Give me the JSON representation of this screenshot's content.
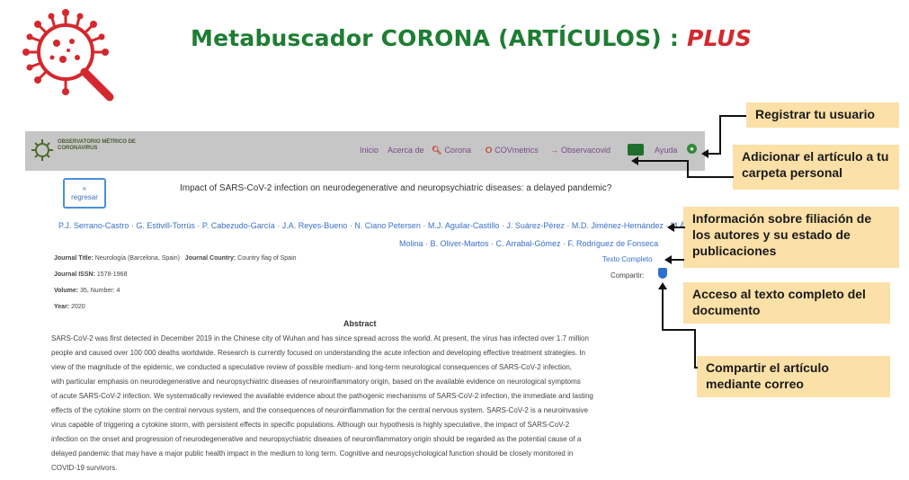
{
  "header": {
    "title_main": "Metabuscador CORONA (ARTÍCULOS) : ",
    "title_plus": "PLUS"
  },
  "navbar": {
    "org_name": "OBSERVATORIO MÉTRICO DE CORONAVIRUS",
    "items": [
      "Inicio",
      "Acerca de",
      "Corona",
      "COVmetrics",
      "Observacovid",
      "Ayuda"
    ]
  },
  "article": {
    "back_label": "regresar",
    "title": "Impact of SARS-CoV-2 infection on neurodegenerative and neuropsychiatric diseases: a delayed pandemic?",
    "authors_line1": "P.J. Serrano-Castro · G. Estivill-Torrús · P. Cabezudo-García · J.A. Reyes-Bueno · N. Ciano Petersen · M.J. Aguilar-Castillo · J. Suárez-Pérez · M.D. Jiménez-Hernández · M.Á. Moya",
    "authors_line2": "Molina · B. Oliver-Martos · C. Arrabal-Gómez · F. Rodríguez de Fonseca",
    "journal_title": "Neurología (Barcelona, Spain)",
    "journal_country": "Country flag of Spain",
    "issn": "1578-1968",
    "volume_number": "35, Number: 4",
    "year": "2020",
    "meta_labels": {
      "journal_title": "Journal Title:",
      "journal_country": "Journal Country:",
      "issn": "Journal ISSN:",
      "volume": "Volume:",
      "year": "Year:"
    },
    "full_text_link": "Texto Completo",
    "share_label": "Compartir:",
    "abstract_heading": "Abstract",
    "abstract_lines": [
      "SARS-CoV-2 was first detected in December 2019 in the Chinese city of Wuhan and has since spread across the world. At present, the virus has infected over 1.7 million",
      "people and caused over 100 000 deaths worldwide. Research is currently focused on understanding the acute infection and developing effective treatment strategies. In",
      "view of the magnitude of the epidemic, we conducted a speculative review of possible medium- and long-term neurological consequences of SARS-CoV-2 infection,",
      "with particular emphasis on neurodegenerative and neuropsychiatric diseases of neuroinflammatory origin, based on the available evidence on neurological symptoms",
      "of acute SARS-CoV-2 infection. We systematically reviewed the available evidence about the pathogenic mechanisms of SARS-CoV-2 infection, the immediate and lasting",
      "effects of the cytokine storm on the central nervous system, and the consequences of neuroinflammation for the central nervous system. SARS-CoV-2 is a neuroinvasive",
      "virus capable of triggering a cytokine storm, with persistent effects in specific populations. Although our hypothesis is highly speculative, the impact of SARS-CoV-2",
      "infection on the onset and progression of neurodegenerative and neuropsychiatric diseases of neuroinflammatory origin should be regarded as the potential cause of a",
      "delayed pandemic that may have a major public health impact in the medium to long term. Cognitive and neuropsychological function should be closely monitored in",
      "COVID-19 survivors."
    ]
  },
  "callouts": {
    "register": "Registrar tu usuario",
    "add_folder": "Adicionar el artículo a tu carpeta personal",
    "affiliation": "Información sobre filiación de los autores y su estado de publicaciones",
    "full_text": "Acceso al texto completo del documento",
    "share": "Compartir el artículo mediante correo"
  },
  "colors": {
    "title_green": "#1e7d33",
    "plus_red": "#d4282e",
    "navbar_gray": "#c6c6c6",
    "callout_bg": "#fbe0a7",
    "link_blue": "#3a6fc8"
  }
}
